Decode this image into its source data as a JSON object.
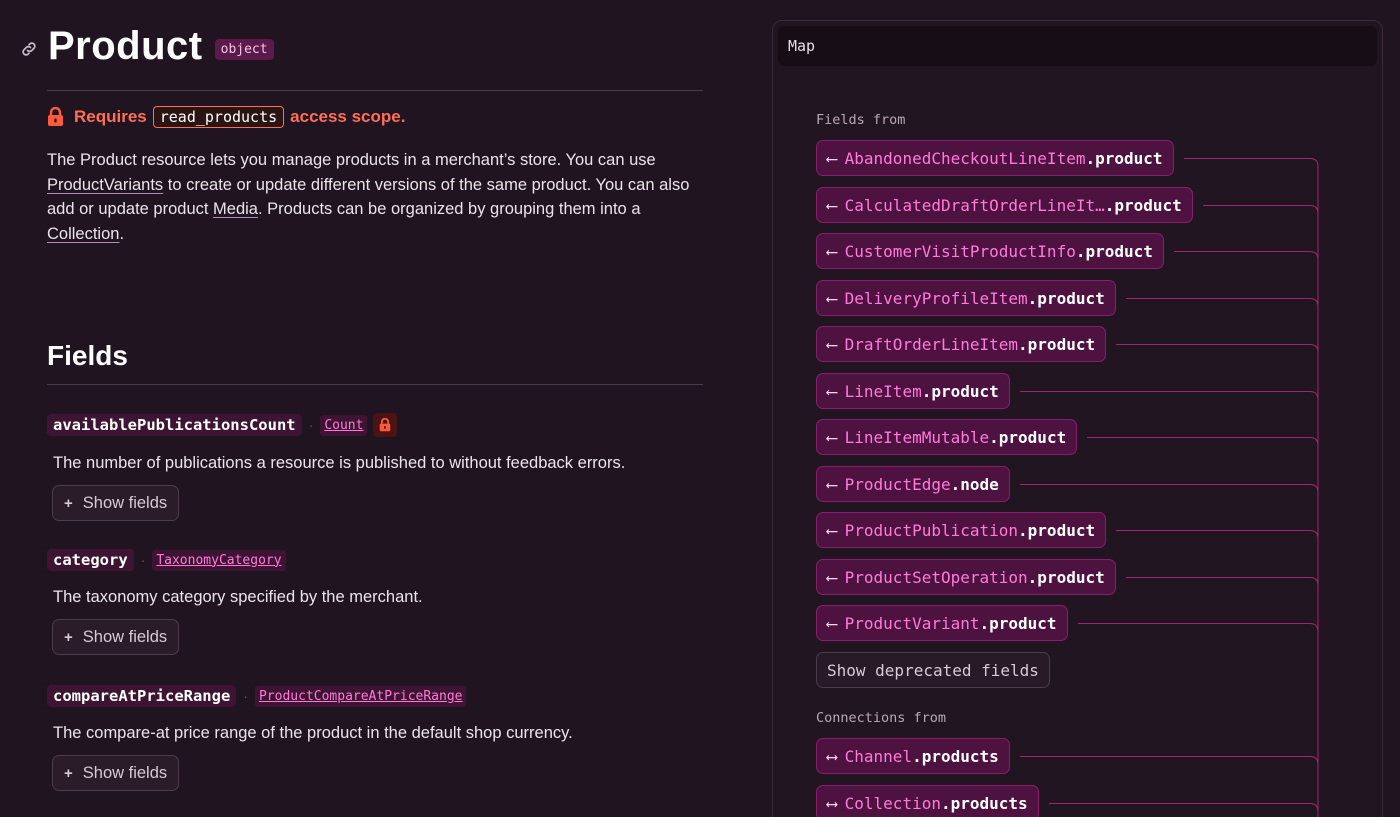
{
  "header": {
    "title": "Product",
    "type_badge": "object"
  },
  "scope": {
    "prefix": "Requires",
    "code": "read_products",
    "suffix": "access scope."
  },
  "description": {
    "part1": "The Product resource lets you manage products in a merchant’s store. You can use ",
    "link1": "ProductVariants",
    "part2": " to create or update different versions of the same product. You can also add or update product ",
    "link2": "Media",
    "part3": ". Products can be organized by grouping them into a ",
    "link3": "Collection",
    "part4": "."
  },
  "fields_section": {
    "title": "Fields",
    "show_fields_label": "Show fields",
    "items": [
      {
        "name": "availablePublicationsCount",
        "type": "Count",
        "requires_scope": true,
        "description": "The number of publications a resource is published to without feedback errors."
      },
      {
        "name": "category",
        "type": "TaxonomyCategory",
        "requires_scope": false,
        "description": "The taxonomy category specified by the merchant."
      },
      {
        "name": "compareAtPriceRange",
        "type": "ProductCompareAtPriceRange",
        "requires_scope": false,
        "description": "The compare-at price range of the product in the default shop currency."
      }
    ]
  },
  "map": {
    "title": "Map",
    "fields_from_label": "Fields from",
    "fields_from": [
      {
        "type": "AbandonedCheckoutLineItem",
        "field": ".product"
      },
      {
        "type": "CalculatedDraftOrderLineIt…",
        "field": " .product"
      },
      {
        "type": "CustomerVisitProductInfo",
        "field": ".product"
      },
      {
        "type": "DeliveryProfileItem",
        "field": ".product"
      },
      {
        "type": "DraftOrderLineItem",
        "field": ".product"
      },
      {
        "type": "LineItem",
        "field": ".product"
      },
      {
        "type": "LineItemMutable",
        "field": ".product"
      },
      {
        "type": "ProductEdge",
        "field": ".node"
      },
      {
        "type": "ProductPublication",
        "field": ".product"
      },
      {
        "type": "ProductSetOperation",
        "field": ".product"
      },
      {
        "type": "ProductVariant",
        "field": ".product"
      }
    ],
    "show_deprecated_label": "Show deprecated fields",
    "connections_from_label": "Connections from",
    "connections_from": [
      {
        "type": "Channel",
        "field": ".products"
      },
      {
        "type": "Collection",
        "field": ".products"
      }
    ],
    "arrow_field": "⟵",
    "arrow_connection": "⟷"
  },
  "colors": {
    "background": "#1f1420",
    "accent_pink": "#ff7ad9",
    "scope_orange": "#ff6f55",
    "map_item_bg": "#4e1241",
    "connector_line": "#a0276f"
  }
}
